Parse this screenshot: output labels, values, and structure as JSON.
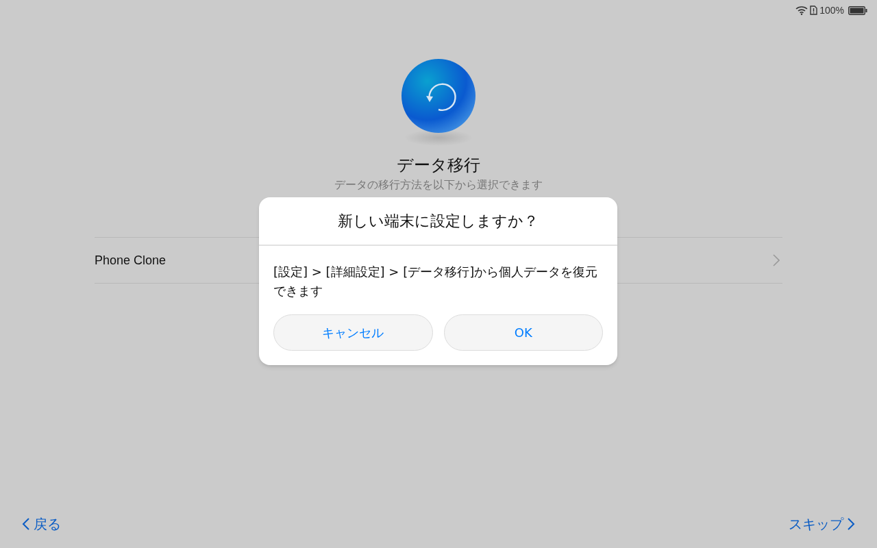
{
  "status_bar": {
    "battery": "100%"
  },
  "header": {
    "title": "データ移行",
    "subtitle": "データの移行方法を以下から選択できます"
  },
  "list": [
    {
      "label": "Phone Clone"
    }
  ],
  "navigation": {
    "back": "戻る",
    "skip": "スキップ"
  },
  "dialog": {
    "title": "新しい端末に設定しますか？",
    "message": "[設定] > [詳細設定] > [データ移行]から個人データを復元できます",
    "buttons": [
      {
        "label": "キャンセル"
      },
      {
        "label": "OK"
      }
    ]
  }
}
